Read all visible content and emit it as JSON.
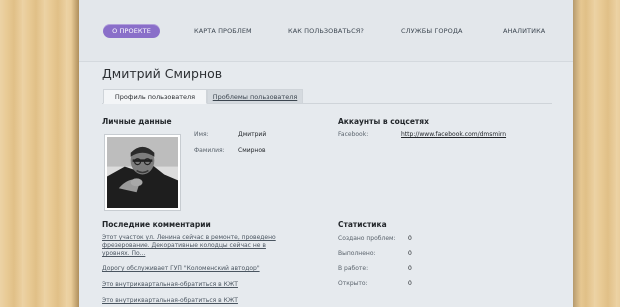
{
  "nav": {
    "items": [
      "О ПРОЕКТЕ",
      "КАРТА ПРОБЛЕМ",
      "КАК ПОЛЬЗОВАТЬСЯ?",
      "СЛУЖБЫ ГОРОДА",
      "АНАЛИТИКА"
    ]
  },
  "profile": {
    "name": "Дмитрий Смирнов"
  },
  "tabs": [
    "Профиль пользователя",
    "Проблемы пользователя"
  ],
  "personal": {
    "title": "Личные данные",
    "first_name_label": "Имя:",
    "first_name": "Дмитрий",
    "last_name_label": "Фамилия:",
    "last_name": "Смирнов"
  },
  "accounts": {
    "title": "Аккаунты в соцсетях",
    "facebook_label": "Facebook:",
    "facebook_url": "http://www.facebook.com/dmsmirn"
  },
  "comments": {
    "title": "Последние комментарии",
    "items": [
      "Этот участок ул. Ленина сейчас в ремонте, проведено фрезерование. Декоративные колодцы сейчас не в уровнях. По...",
      "Дорогу обслуживает ГУП \"Коломенский автодор\"",
      "Это внутриквартальная-обратиться в КЖТ",
      "Это внутриквартальная-обратиться в КЖТ"
    ]
  },
  "stats": {
    "title": "Статистика",
    "rows": [
      {
        "label": "Создано проблем:",
        "value": "0"
      },
      {
        "label": "Выполнено:",
        "value": "0"
      },
      {
        "label": "В работе:",
        "value": "0"
      },
      {
        "label": "Открыто:",
        "value": "0"
      }
    ]
  },
  "colors": {
    "accent": "#8a6fc9",
    "page_bg": "#e6eaee",
    "wood": "#e8c992"
  }
}
